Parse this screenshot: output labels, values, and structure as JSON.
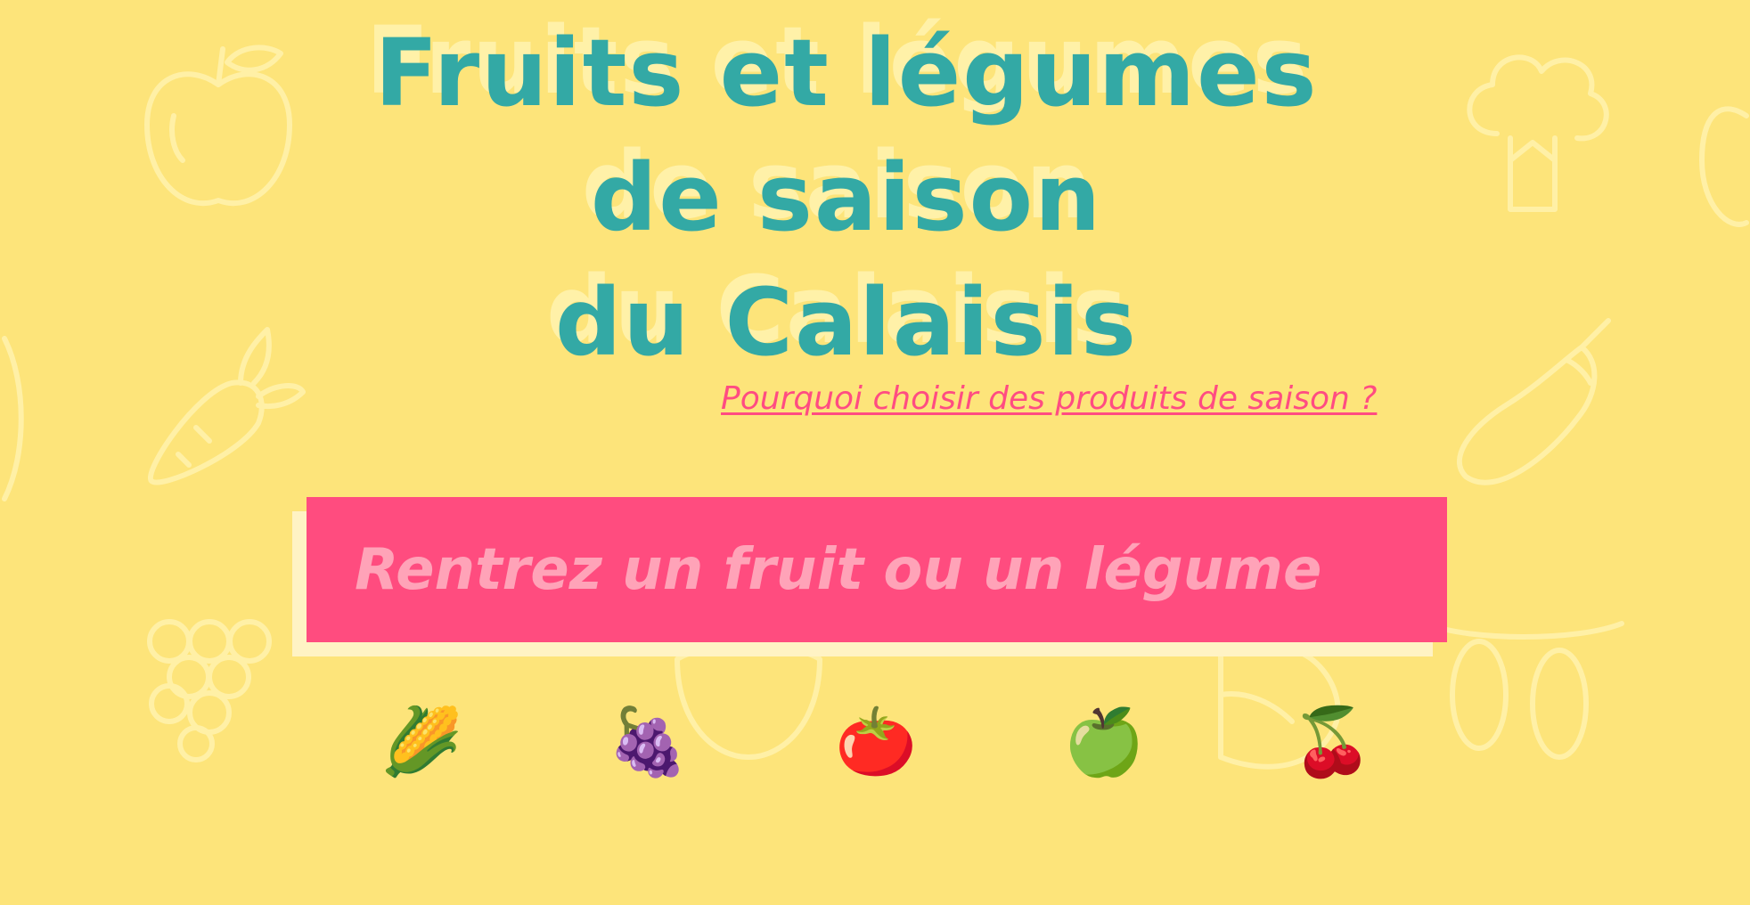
{
  "title": {
    "line1": "Fruits et légumes",
    "line2": "de saison",
    "line3": "du Calaisis"
  },
  "why_link": "Pourquoi choisir des produits de saison ?",
  "search": {
    "placeholder": "Rentrez un fruit ou un légume",
    "value": ""
  },
  "emojis": [
    {
      "name": "corn-emoji",
      "glyph": "🌽"
    },
    {
      "name": "grapes-emoji",
      "glyph": "🍇"
    },
    {
      "name": "tomato-emoji",
      "glyph": "🍅"
    },
    {
      "name": "green-apple-emoji",
      "glyph": "🍏"
    },
    {
      "name": "cherries-emoji",
      "glyph": "🍒"
    }
  ],
  "colors": {
    "background": "#fde47a",
    "title": "#33a9a5",
    "title_shadow": "#fff1a8",
    "accent_pink": "#ff4c7f",
    "placeholder": "#ffa3b8"
  },
  "background_icons": [
    "apple-icon",
    "broccoli-icon",
    "carrot-icon",
    "eggplant-icon",
    "grapes-icon",
    "peas-icon",
    "pepper-icon",
    "plums-icon"
  ]
}
